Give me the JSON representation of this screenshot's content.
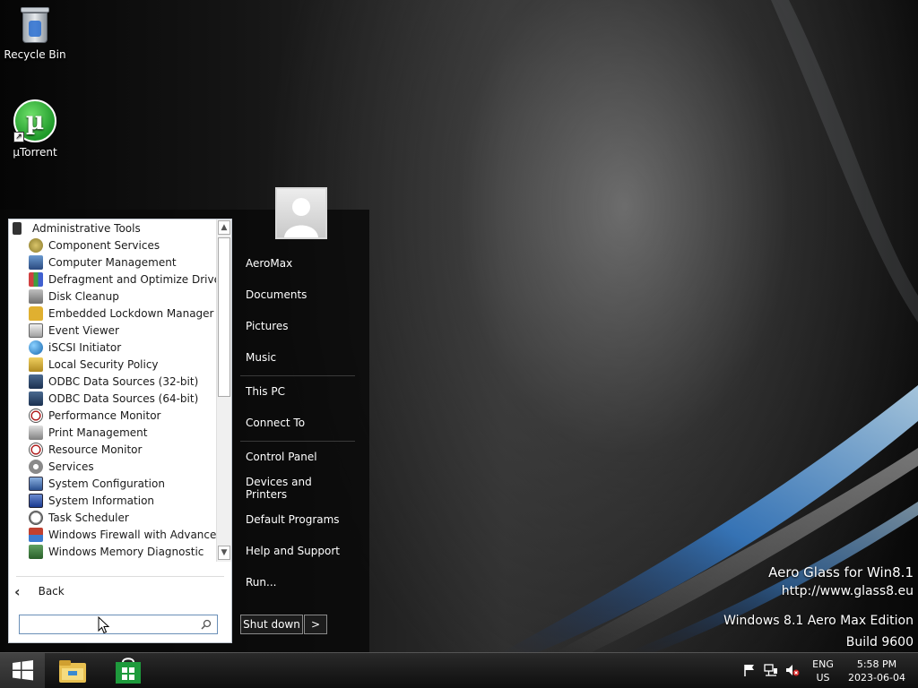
{
  "desktop": {
    "icons": [
      {
        "label": "Recycle Bin",
        "icon": "recycle-bin-icon"
      },
      {
        "label": "µTorrent",
        "icon": "utorrent-icon"
      }
    ]
  },
  "start_menu": {
    "programs": {
      "folder": {
        "label": "Administrative Tools",
        "icon": "folder-icon"
      },
      "items": [
        {
          "label": "Component Services",
          "icon": "component-services-icon"
        },
        {
          "label": "Computer Management",
          "icon": "computer-management-icon"
        },
        {
          "label": "Defragment and Optimize Drives",
          "icon": "defragment-icon"
        },
        {
          "label": "Disk Cleanup",
          "icon": "disk-cleanup-icon"
        },
        {
          "label": "Embedded Lockdown Manager",
          "icon": "lock-icon"
        },
        {
          "label": "Event Viewer",
          "icon": "event-viewer-icon"
        },
        {
          "label": "iSCSI Initiator",
          "icon": "globe-icon"
        },
        {
          "label": "Local Security Policy",
          "icon": "security-policy-icon"
        },
        {
          "label": "ODBC Data Sources (32-bit)",
          "icon": "odbc-icon"
        },
        {
          "label": "ODBC Data Sources (64-bit)",
          "icon": "odbc-icon"
        },
        {
          "label": "Performance Monitor",
          "icon": "gauge-icon"
        },
        {
          "label": "Print Management",
          "icon": "printer-icon"
        },
        {
          "label": "Resource Monitor",
          "icon": "gauge-icon"
        },
        {
          "label": "Services",
          "icon": "gear-icon"
        },
        {
          "label": "System Configuration",
          "icon": "system-configuration-icon"
        },
        {
          "label": "System Information",
          "icon": "system-information-icon"
        },
        {
          "label": "Task Scheduler",
          "icon": "clock-icon"
        },
        {
          "label": "Windows Firewall with Advanced Se",
          "icon": "firewall-icon"
        },
        {
          "label": "Windows Memory Diagnostic",
          "icon": "memory-diagnostic-icon"
        }
      ]
    },
    "back_label": "Back",
    "search": {
      "value": "",
      "placeholder": ""
    },
    "right_links": [
      "AeroMax",
      "Documents",
      "Pictures",
      "Music",
      "This PC",
      "Connect To",
      "Control Panel",
      "Devices and Printers",
      "Default Programs",
      "Help and Support",
      "Run..."
    ],
    "shutdown_label": "Shut down",
    "shutdown_arrow": ">"
  },
  "watermark": {
    "line1": "Aero Glass for Win8.1",
    "line2": "http://www.glass8.eu",
    "line3": "Windows 8.1 Aero Max Edition",
    "line4": "Build 9600"
  },
  "taskbar": {
    "pinned": [
      {
        "icon": "file-explorer-icon"
      },
      {
        "icon": "store-icon"
      }
    ],
    "tray": {
      "lang_line1": "ENG",
      "lang_line2": "US",
      "time": "5:58 PM",
      "date": "2023-06-04"
    }
  },
  "colors": {
    "start_menu_bg": "#080808",
    "program_pane_bg": "#ffffff",
    "taskbar_bg": "#141414",
    "accent_blue": "#2a6fd0"
  }
}
